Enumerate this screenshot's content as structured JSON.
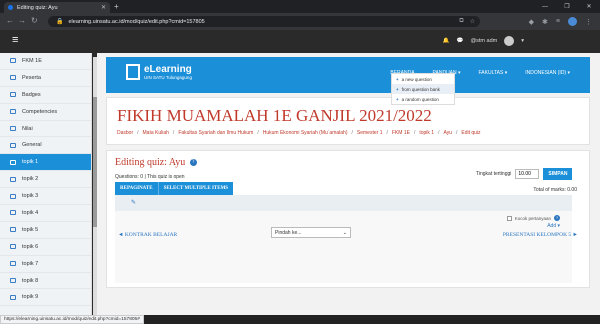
{
  "browser": {
    "tab_title": "Editing quiz: Ayu",
    "url": "elearning.uinsatu.ac.id/mod/quiz/edit.php?cmid=157805",
    "status_url": "https://elearning.uinsatu.ac.id/mod/quiz/edit.php?cmid=157805#"
  },
  "topnav": {
    "user": "@stm adm"
  },
  "sidebar": {
    "items": [
      {
        "label": "FKM 1E",
        "active": false
      },
      {
        "label": "Peserta",
        "active": false
      },
      {
        "label": "Badges",
        "active": false
      },
      {
        "label": "Competencies",
        "active": false
      },
      {
        "label": "Nilai",
        "active": false
      },
      {
        "label": "General",
        "active": false
      },
      {
        "label": "topik 1",
        "active": true
      },
      {
        "label": "topik 2",
        "active": false
      },
      {
        "label": "topik 3",
        "active": false
      },
      {
        "label": "topik 4",
        "active": false
      },
      {
        "label": "topik 5",
        "active": false
      },
      {
        "label": "topik 6",
        "active": false
      },
      {
        "label": "topik 7",
        "active": false
      },
      {
        "label": "topik 8",
        "active": false
      },
      {
        "label": "topik 9",
        "active": false
      }
    ]
  },
  "banner": {
    "logo_title": "eLearning",
    "logo_subtitle": "UIN SATU Tulungagung",
    "menu": [
      "BERANDA",
      "PANDUAN ▾",
      "FAKULTAS ▾",
      "INDONESIAN (ID) ▾"
    ]
  },
  "course": {
    "title": "FIKIH MUAMALAH 1E GANJIL 2021/2022",
    "breadcrumb": [
      "Dasbor",
      "Mata Kuliah",
      "Fakultas Syariah dan Ilmu Hukum",
      "Hukum Ekonomi Syariah (Mu`amalah)",
      "Semester 1",
      "FKM 1E",
      "topik 1",
      "Ayu",
      "Edit quiz"
    ]
  },
  "quiz": {
    "heading": "Editing quiz: Ayu",
    "info": "Questions: 0 | This quiz is open",
    "max_grade_label": "Tingkat tertinggi",
    "max_grade_value": "10.00",
    "save_label": "SIMPAN",
    "total_marks": "Total of marks: 0.00",
    "repaginate": "REPAGINATE",
    "select_multiple": "SELECT MULTIPLE ITEMS",
    "shuffle_label": "Kocok pertanyaan",
    "add_label": "Add ▾",
    "add_menu": [
      "a new question",
      "from question bank",
      "a random question"
    ]
  },
  "footer": {
    "prev_label": "◄ KONTRAK BELAJAR",
    "jump_placeholder": "Pindah ke...",
    "next_label": "PRESENTASI KELOMPOK 5 ►"
  }
}
